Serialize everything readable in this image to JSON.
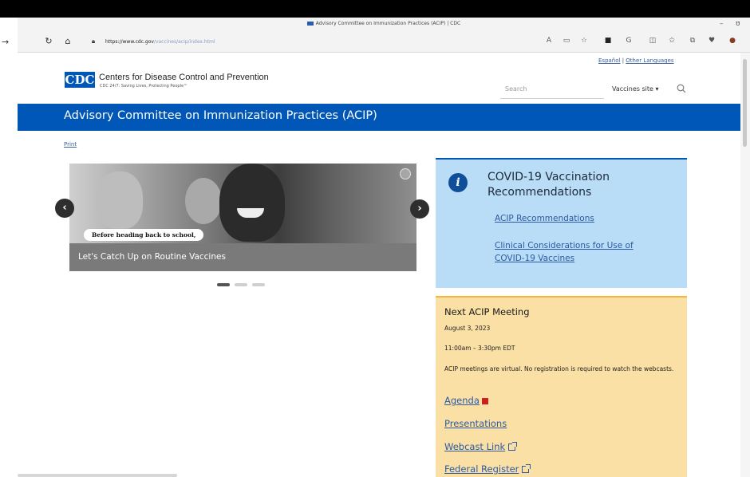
{
  "browser": {
    "tab_title": "Advisory Committee on Immunization Practices (ACIP) | CDC",
    "url_domain": "https://www.cdc.gov",
    "url_path": "/vaccines/acip/index.html",
    "minimize": "–",
    "extra_ctrl": "ʊ"
  },
  "header": {
    "lang_espanol": "Español",
    "lang_separator": " | ",
    "lang_other": "Other Languages",
    "logo_text": "CDC",
    "org_name": "Centers for Disease Control and Prevention",
    "tagline": "CDC 24/7: Saving Lives, Protecting People™",
    "search_placeholder": "Search",
    "site_select": "Vaccines site ▾"
  },
  "banner": {
    "title": "Advisory Committee on Immunization Practices (ACIP)"
  },
  "print_label": "Print",
  "carousel": {
    "tag_text": "Before heading back to school,",
    "caption": "Let's Catch Up on Routine Vaccines",
    "prev_label": "‹",
    "next_label": "›",
    "slide_count": 3,
    "active_slide": 1
  },
  "covid": {
    "title": "COVID-19 Vaccination Recommendations",
    "link1": "ACIP Recommendations",
    "link2": "Clinical Considerations for Use of COVID-19 Vaccines"
  },
  "meeting": {
    "title": "Next ACIP Meeting",
    "date": "August 3, 2023",
    "time": "11:00am – 3:30pm EDT",
    "description": "ACIP meetings are virtual. No registration is required to watch the webcasts.",
    "links": [
      "Agenda",
      "Presentations",
      "Webcast Link",
      "Federal Register"
    ]
  },
  "colors": {
    "cdc_blue": "#0057b7",
    "covid_bg": "#b9dcf7",
    "meeting_bg": "#fbe0a6",
    "link": "#2c5aa3"
  }
}
